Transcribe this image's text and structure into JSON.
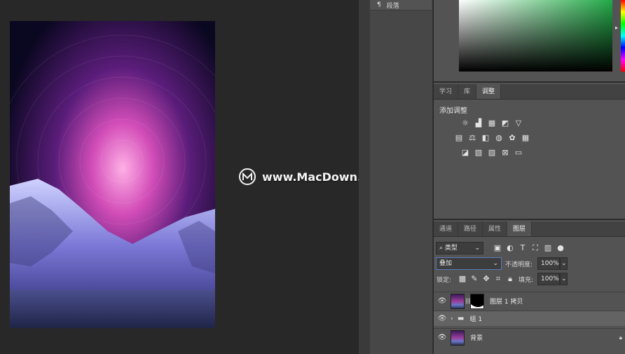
{
  "dock": {
    "label": "段落"
  },
  "adjustments": {
    "tabs": [
      "学习",
      "库",
      "调整"
    ],
    "active_tab": 2,
    "title": "添加调整"
  },
  "layers": {
    "tabs": [
      "通道",
      "路径",
      "属性",
      "图层"
    ],
    "active_tab": 3,
    "filter": {
      "label": "类型"
    },
    "blend_mode": "叠加",
    "opacity_label": "不透明度:",
    "opacity_value": "100%",
    "lock_label": "锁定:",
    "fill_label": "填充:",
    "fill_value": "100%",
    "items": [
      {
        "name": "图层 1 拷贝",
        "visible": true,
        "has_mask": true
      },
      {
        "name": "组 1",
        "visible": true,
        "is_group": true,
        "collapsed": true
      },
      {
        "name": "背景",
        "visible": true,
        "locked": true
      }
    ]
  },
  "watermark": {
    "text": "www.MacDown.com"
  },
  "colors": {
    "accent_green": "#23a948",
    "panel": "#535353",
    "dark": "#282828"
  }
}
